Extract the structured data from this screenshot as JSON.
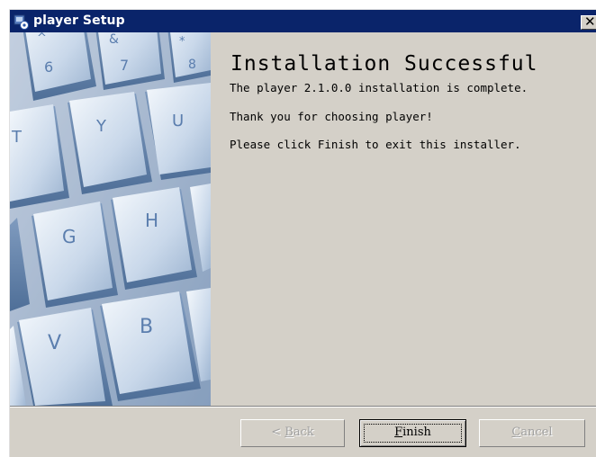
{
  "window": {
    "title": "player Setup",
    "close_glyph": "✕"
  },
  "icons": {
    "app": "setup-installer-icon",
    "close": "close-icon"
  },
  "content": {
    "heading": "Installation Successful",
    "line1": "The player 2.1.0.0 installation is complete.",
    "line2": "Thank you for choosing player!",
    "line3": "Please click Finish to exit this installer."
  },
  "keyboard_image": {
    "keys": [
      "^",
      "6",
      "&",
      "7",
      "*",
      "8",
      "T",
      "Y",
      "U",
      "G",
      "H",
      "V",
      "B"
    ]
  },
  "buttons": {
    "back": {
      "prefix": "< ",
      "accel": "B",
      "rest": "ack",
      "enabled": false
    },
    "finish": {
      "accel": "F",
      "rest": "inish",
      "enabled": true,
      "default": true
    },
    "cancel": {
      "accel": "C",
      "rest": "ancel",
      "enabled": false
    }
  },
  "colors": {
    "titlebar": "#0a246a",
    "dialog_face": "#d4d0c8",
    "key_tint": "#a9bdd6"
  }
}
